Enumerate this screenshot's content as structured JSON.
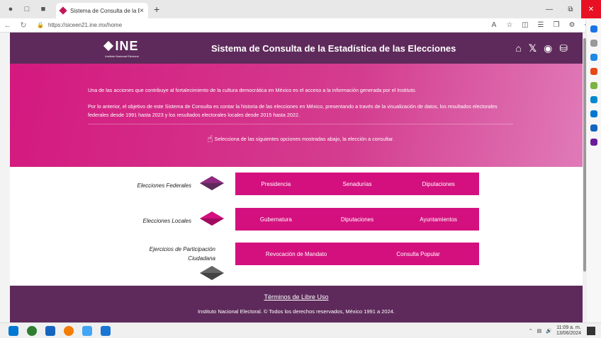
{
  "browser": {
    "tab_title": "Sistema de Consulta de la Estadí",
    "url": "https://siceen21.ine.mx/home"
  },
  "header": {
    "logo_text": "INE",
    "logo_subtext": "Instituto Nacional Electoral",
    "title": "Sistema de Consulta de la Estadística de las Elecciones"
  },
  "hero": {
    "paragraph1": "Una de las acciones que contribuye al fortalecimiento de la cultura democrática en México es el acceso a la información generada por el Instituto.",
    "paragraph2": "Por lo anterior, el objetivo de este Sistema de Consulta es contar la historia de las elecciones en México, presentando a través de la visualización de datos, los resultados electorales federales desde 1991 hasta 2023 y los resultados electorales locales desde 2015 hasta 2022.",
    "select_prompt": "Selecciona de las siguientes opciones mostradas abajo, la elección a consultar."
  },
  "sections": [
    {
      "label": "Elecciones Federales",
      "options": [
        "Presidencia",
        "Senadurías",
        "Diputaciones"
      ],
      "diamond_color": "#8e2a7f"
    },
    {
      "label": "Elecciones Locales",
      "options": [
        "Gubernatura",
        "Diputaciones",
        "Ayuntamientos"
      ],
      "diamond_color": "#d4107f"
    },
    {
      "label_line1": "Ejercicios de Participación",
      "label_line2": "Ciudadana",
      "options": [
        "Revocación de Mandato",
        "Consulta Popular"
      ],
      "diamond_color": "#555555"
    }
  ],
  "footer": {
    "terms": "Términos de Libre Uso",
    "copyright": "Instituto Nacional Electoral. © Todos los derechos reservados, México 1991 a 2024."
  },
  "taskbar": {
    "time": "11:09 a. m.",
    "date": "13/06/2024"
  },
  "colors": {
    "header_bg": "#5e2a5b",
    "accent": "#d4107f"
  }
}
